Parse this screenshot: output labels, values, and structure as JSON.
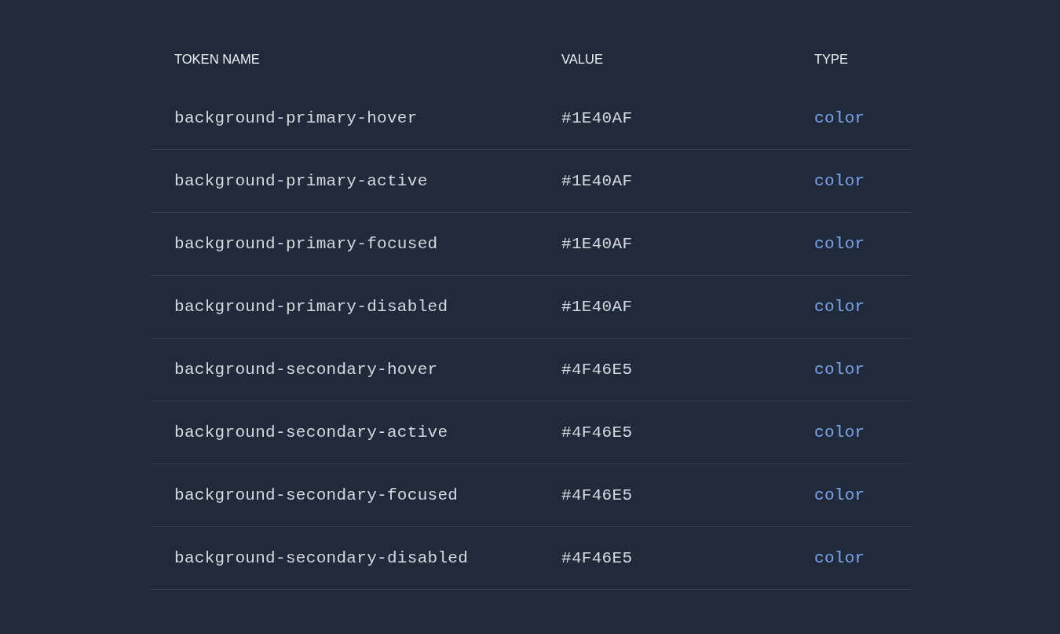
{
  "table": {
    "columns": [
      "TOKEN NAME",
      "VALUE",
      "TYPE"
    ],
    "rows": [
      {
        "name": "background-primary-hover",
        "value": "#1E40AF",
        "type": "color"
      },
      {
        "name": "background-primary-active",
        "value": "#1E40AF",
        "type": "color"
      },
      {
        "name": "background-primary-focused",
        "value": "#1E40AF",
        "type": "color"
      },
      {
        "name": "background-primary-disabled",
        "value": "#1E40AF",
        "type": "color"
      },
      {
        "name": "background-secondary-hover",
        "value": "#4F46E5",
        "type": "color"
      },
      {
        "name": "background-secondary-active",
        "value": "#4F46E5",
        "type": "color"
      },
      {
        "name": "background-secondary-focused",
        "value": "#4F46E5",
        "type": "color"
      },
      {
        "name": "background-secondary-disabled",
        "value": "#4F46E5",
        "type": "color"
      }
    ]
  }
}
